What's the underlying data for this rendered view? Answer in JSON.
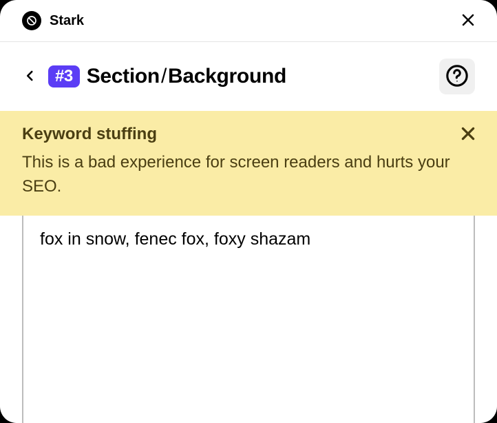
{
  "app": {
    "title": "Stark"
  },
  "header": {
    "badge": "#3",
    "breadcrumb_first": "Section",
    "breadcrumb_separator": "/",
    "breadcrumb_second": "Background"
  },
  "alert": {
    "title": "Keyword stuffing",
    "body": "This is a bad experience for screen readers and hurts your SEO."
  },
  "content": {
    "text": "fox in snow, fenec fox, foxy shazam"
  },
  "colors": {
    "badge_bg": "#5b3df5",
    "alert_bg": "#faeca6",
    "alert_text": "#4a3e12"
  }
}
